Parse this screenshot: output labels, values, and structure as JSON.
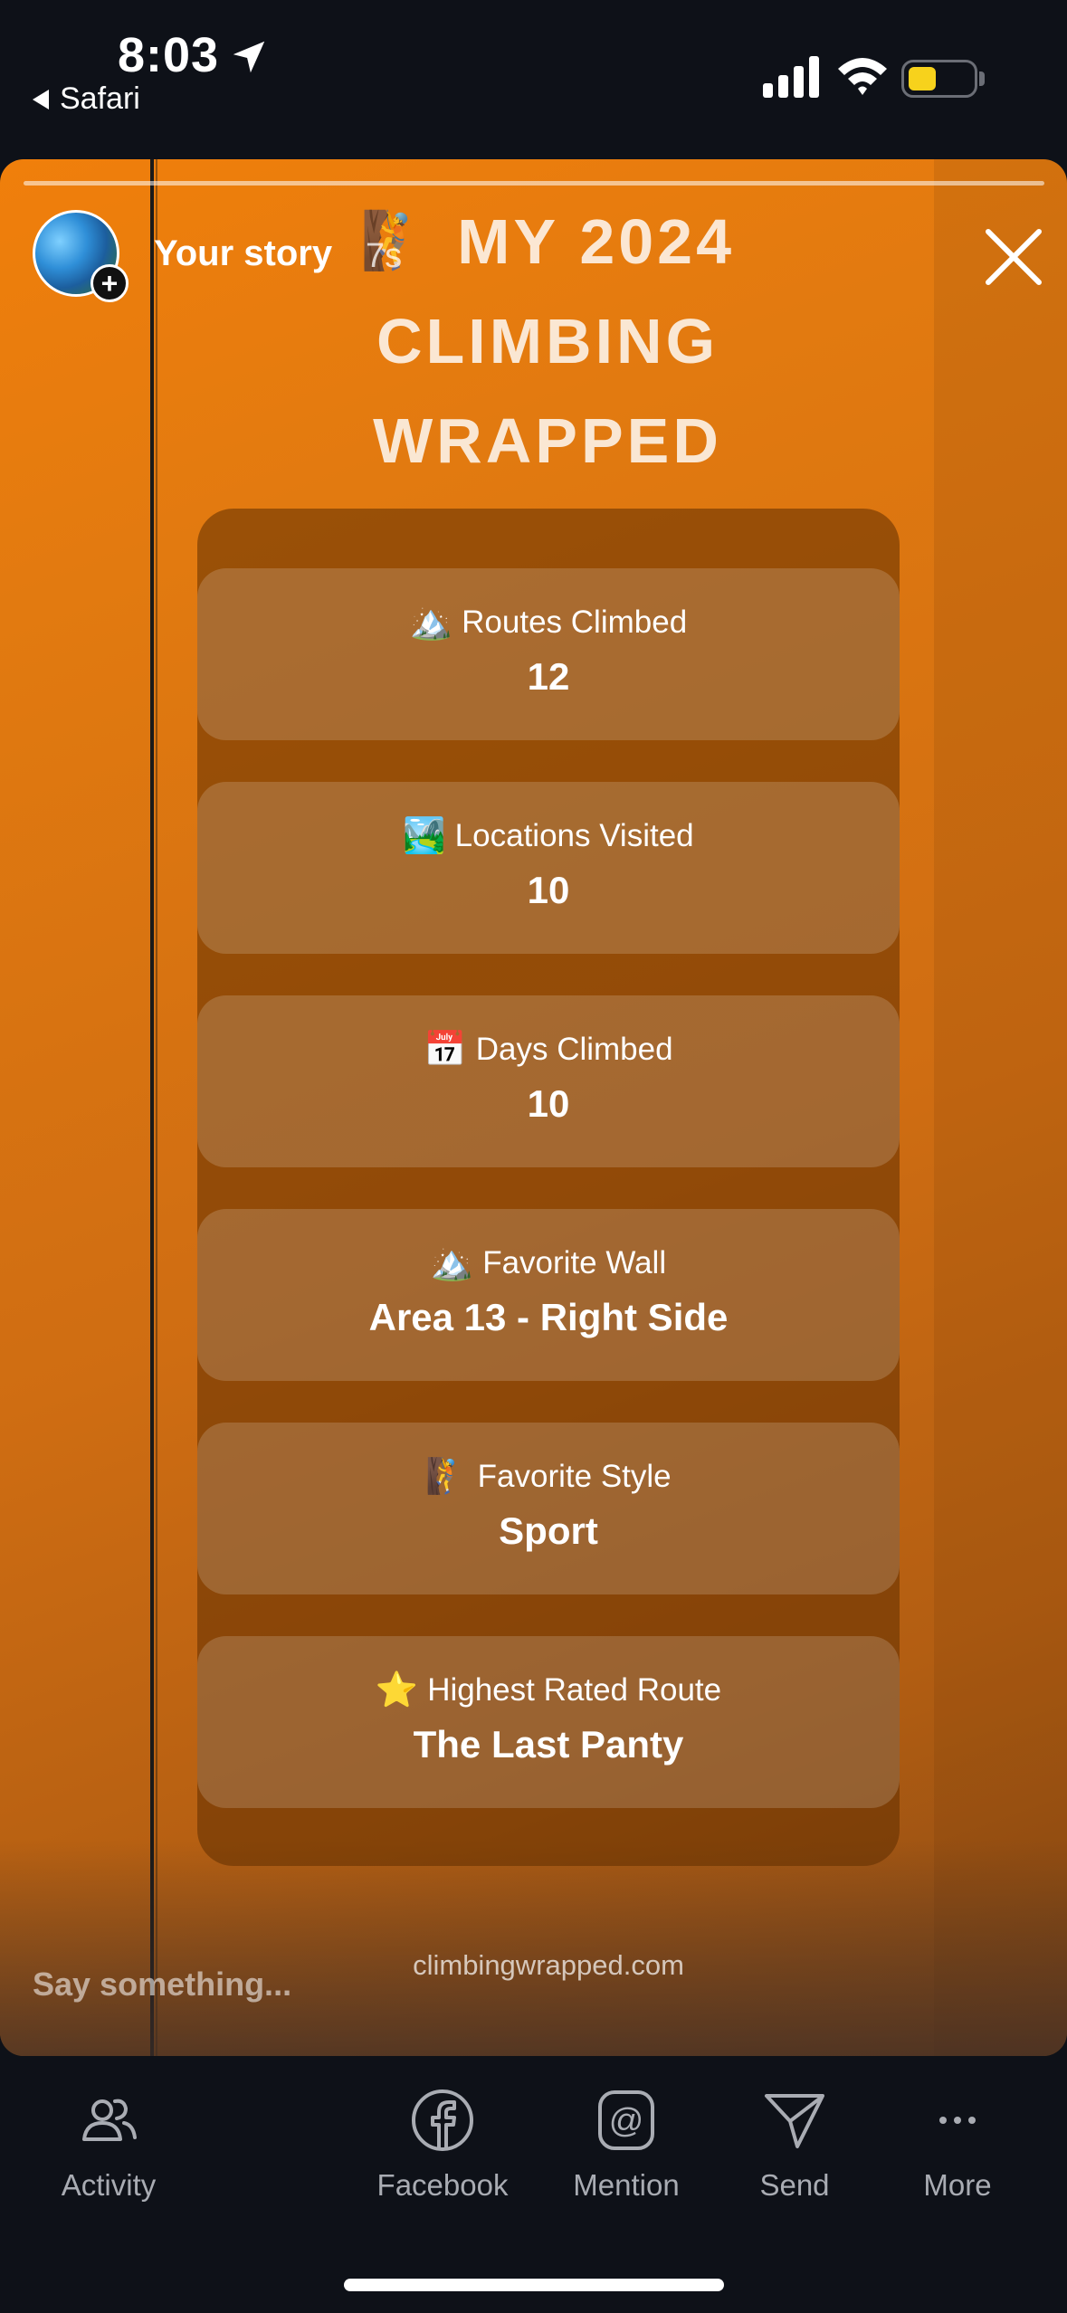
{
  "status_bar": {
    "time": "8:03",
    "back_app": "Safari",
    "battery_color": "#f7d21c"
  },
  "story": {
    "owner": "Your story",
    "age": "7s",
    "title_line1": "MY 2024",
    "title_line2": "CLIMBING",
    "title_line3": "WRAPPED",
    "title_emoji": "🧗",
    "stats": [
      {
        "emoji": "🏔️",
        "label": "Routes Climbed",
        "value": "12"
      },
      {
        "emoji": "🏞️",
        "label": "Locations Visited",
        "value": "10"
      },
      {
        "emoji": "📅",
        "label": "Days Climbed",
        "value": "10"
      },
      {
        "emoji": "🏔️",
        "label": "Favorite Wall",
        "value": "Area 13 - Right Side"
      },
      {
        "emoji": "🧗",
        "label": "Favorite Style",
        "value": "Sport"
      },
      {
        "emoji": "⭐",
        "label": "Highest Rated Route",
        "value": "The Last Panty"
      }
    ],
    "footer_url": "climbingwrapped.com",
    "reply_placeholder": "Say something...",
    "accent_color": "#f07f0b"
  },
  "bottom_bar": {
    "activity": "Activity",
    "facebook": "Facebook",
    "mention": "Mention",
    "send": "Send",
    "more": "More"
  }
}
